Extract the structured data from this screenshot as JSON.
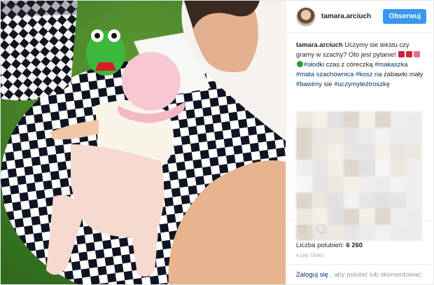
{
  "post": {
    "username": "tamara.arciuch",
    "follow_label": "Obserwuj",
    "caption_user": "tamara.arciuch",
    "caption_parts": [
      {
        "text": " Uczymy sie tekstu czy gramy w szachy? Oto jest pytanie! ",
        "tag": false
      },
      {
        "text": "#słodki",
        "tag": true
      },
      {
        "text": " czas z córeczką ",
        "tag": false
      },
      {
        "text": "#makaszka",
        "tag": true
      },
      {
        "text": " ",
        "tag": false
      },
      {
        "text": "#mata szachownica",
        "tag": true
      },
      {
        "text": " ",
        "tag": false
      },
      {
        "text": "#kosz",
        "tag": true
      },
      {
        "text": " na zabawki mały ",
        "tag": false
      },
      {
        "text": "#bawimy",
        "tag": true
      },
      {
        "text": " sie ",
        "tag": false
      },
      {
        "text": "#uczymyteżtroszkę",
        "tag": true
      }
    ],
    "likes_label": "Liczba polubień:",
    "likes_count": "6 260",
    "time_ago": "4 DNI TEMU",
    "footer": {
      "login_link": "Zaloguj się",
      "login_rest": ", aby polubić lub skomentować."
    },
    "icons": {
      "like": "heart-icon",
      "comment": "comment-icon",
      "more": "more-icon"
    },
    "colors": {
      "follow": "#3897f0",
      "hashtag": "#003569"
    }
  }
}
